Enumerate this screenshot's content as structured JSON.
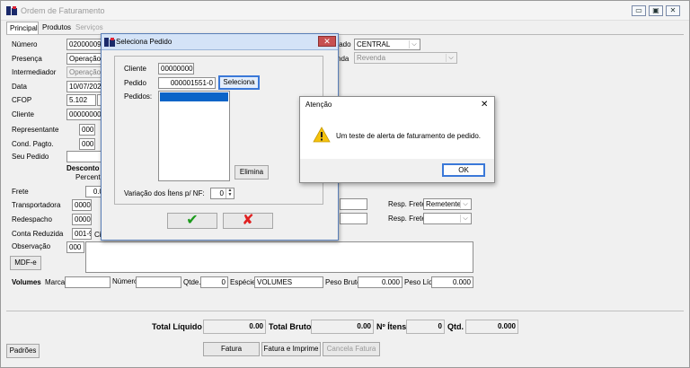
{
  "window": {
    "title": "Ordem de Faturamento",
    "min": "▭",
    "max": "▣",
    "close": "✕"
  },
  "tabs": [
    {
      "label": "Principal"
    },
    {
      "label": "Produtos"
    },
    {
      "label": "Serviços"
    }
  ],
  "form": {
    "numero_label": "Número",
    "numero_value": "02000009",
    "presenca_label": "Presença",
    "presenca_value": "Operação",
    "intermediador_label": "Intermediador",
    "intermediador_value": "Operação",
    "data_label": "Data",
    "data_value": "10/07/2023",
    "cfop_label": "CFOP",
    "cfop_value": "5.102",
    "cliente_label": "Cliente",
    "cliente_value": "00000000",
    "representante_label": "Representante",
    "representante_value": "000",
    "condpagto_label": "Cond. Pagto.",
    "condpagto_value": "000",
    "seupedido_label": "Seu Pedido",
    "desconto_label": "Desconto",
    "percentual_label": "Percentu",
    "frete_label": "Frete",
    "frete_value": "0.0",
    "transportadora_label": "Transportadora",
    "transportadora_value": "0000",
    "redespacho_label": "Redespacho",
    "redespacho_value": "0000",
    "contareduzida_label": "Conta Reduzida",
    "contareduzida_value": "001-9",
    "contareduzida_suffix": "Ci",
    "observacao_label": "Observação",
    "observacao_value": "000",
    "mdfe_label": "MDF-e",
    "estado_label": "tado",
    "estado_value": "CENTRAL",
    "venda_label": "nda",
    "venda_value": "Revenda",
    "respfrete1_label": "Resp. Frete",
    "respfrete1_value": "Remetente",
    "respfrete2_label": "Resp. Frete",
    "respfrete2_value": "",
    "volumes_label": "Volumes",
    "marca_label": "Marca",
    "marca_value": "",
    "numero2_label": "Número",
    "numero2_value": "",
    "qtde_label": "Qtde.",
    "qtde_value": "0",
    "especie_label": "Espécie",
    "especie_value": "VOLUMES",
    "pesobruto_label": "Peso Bruto",
    "pesobruto_value": "0.000",
    "pesoliq_label": "Peso Líq.",
    "pesoliq_value": "0.000"
  },
  "totals": {
    "liquido_label": "Total Líquido",
    "liquido_value": "0.00",
    "bruto_label": "Total Bruto",
    "bruto_value": "0.00",
    "itens_label": "Nº Ítens",
    "itens_value": "0",
    "qtd_label": "Qtd.",
    "qtd_value": "0.000"
  },
  "buttons": {
    "fatura": "Fatura",
    "fatura_imprime": "Fatura e Imprime",
    "cancela": "Cancela Fatura",
    "padroes": "Padrões"
  },
  "dialog_pedido": {
    "title": "Seleciona Pedido",
    "cliente_label": "Cliente",
    "cliente_value": "00000000",
    "pedido_label": "Pedido",
    "pedido_value": "000001551-0",
    "seleciona_button": "Seleciona",
    "pedidos_label": "Pedidos:",
    "elimina_button": "Elimina",
    "variacao_label": "Variação dos Ítens p/ NF:",
    "variacao_value": "0",
    "ok_icon": "✔",
    "cancel_icon": "✘"
  },
  "alert": {
    "title": "Atenção",
    "message": "Um teste de alerta de faturamento de pedido.",
    "ok_button": "OK",
    "close": "✕"
  },
  "colors": {
    "accent": "#0a64c8",
    "ok_green": "#1a9a1a",
    "cancel_red": "#e02020",
    "warning": "#f4c20d"
  }
}
